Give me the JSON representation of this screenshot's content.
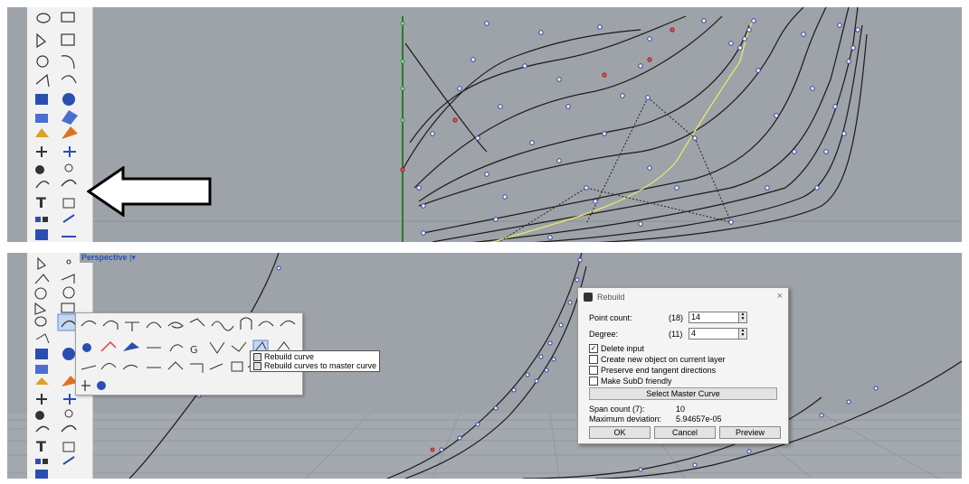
{
  "bottom_viewport": {
    "label": "Perspective",
    "menu_caret": "|▾"
  },
  "tooltip": {
    "items": [
      "Rebuild curve",
      "Rebuild curves to master curve"
    ]
  },
  "rebuild_dialog": {
    "title": "Rebuild",
    "close": "×",
    "point_count_label": "Point count:",
    "point_count_prev": "(18)",
    "point_count_value": "14",
    "degree_label": "Degree:",
    "degree_prev": "(11)",
    "degree_value": "4",
    "options": [
      {
        "label": "Delete input",
        "checked": true
      },
      {
        "label": "Create new object on current layer",
        "checked": false
      },
      {
        "label": "Preserve end tangent directions",
        "checked": false
      },
      {
        "label": "Make SubD friendly",
        "checked": false
      }
    ],
    "select_master_label": "Select Master Curve",
    "span_count_label": "Span count (7):",
    "span_count_value": "10",
    "max_dev_label": "Maximum deviation:",
    "max_dev_value": "5.94657e-05",
    "ok_label": "OK",
    "cancel_label": "Cancel",
    "preview_label": "Preview"
  },
  "icons": {
    "toolbar_top": [
      "ellipse-tool-icon",
      "polyline-tool-icon",
      "circle-tool-icon",
      "arc-tool-icon",
      "point-edit-icon",
      "solid-box-icon",
      "sphere-solid-icon",
      "extrude-icon",
      "surface-icon",
      "explode-icon",
      "transform-icon",
      "align-icon",
      "boolean-icon",
      "analyze-icon",
      "curve-tool-icon",
      "rebuild-curve-icon",
      "text-tool-icon",
      "dimension-icon",
      "layout-icon",
      "render-icon",
      "mesh-icon",
      "snapshot-icon"
    ],
    "arrow": "rebuild-pointer-arrow-icon"
  },
  "colors": {
    "viewport_bg": "#9da3a8",
    "curve": "#1a1a1a",
    "control_point": "#ffffff",
    "control_point_border": "#3a3aa0",
    "selected_point": "#e05050",
    "highlight_curve": "#e8e070",
    "axis_green": "#2a8a2a",
    "label_blue": "#1f4fbf"
  }
}
